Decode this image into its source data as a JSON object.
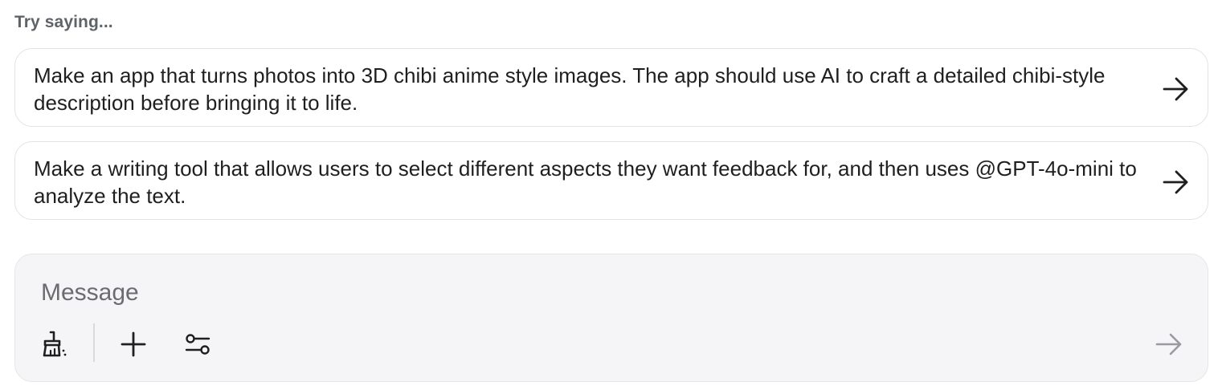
{
  "header": {
    "try_label": "Try saying..."
  },
  "suggestions": [
    {
      "text": "Make an app that turns photos into 3D chibi anime style images. The app should use AI to craft a detailed chibi-style description before bringing it to life.",
      "icon": "arrow-right-icon"
    },
    {
      "text": "Make a writing tool that allows users to select different aspects they want feedback for, and then uses @GPT-4o-mini to analyze the text.",
      "icon": "arrow-right-icon"
    }
  ],
  "composer": {
    "placeholder": "Message",
    "value": "",
    "tools": [
      {
        "icon": "paintbrush-icon"
      },
      {
        "icon": "plus-icon"
      },
      {
        "icon": "sliders-icon"
      }
    ],
    "send_icon": "send-arrow-icon"
  },
  "colors": {
    "background": "#ffffff",
    "composer_bg": "#f5f5f7",
    "card_border": "#e3e3e6",
    "text": "#1f1f1f",
    "muted_text": "#5f6368",
    "send_disabled": "#9a9a9f"
  }
}
